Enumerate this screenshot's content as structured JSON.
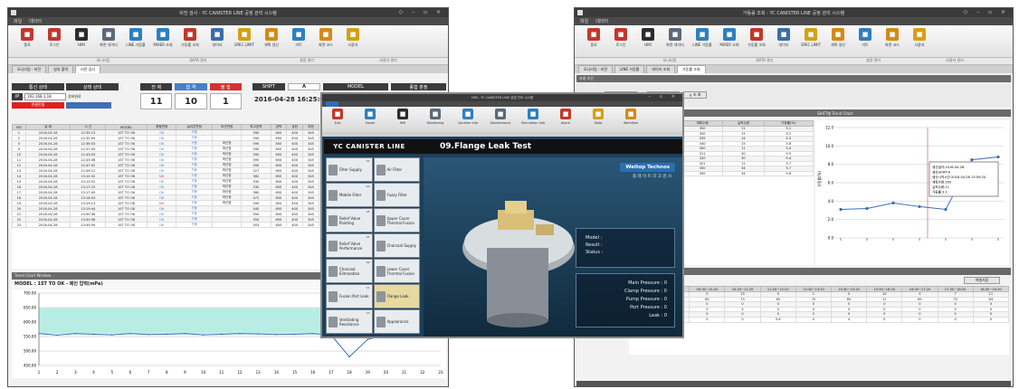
{
  "left": {
    "title": "비전 검사 - YC CANISTER LINE 공정 관리 시스템",
    "menu": [
      "파일",
      "데이터"
    ],
    "ribbon": [
      "종료",
      "로그인",
      "HMI",
      "화면 데이터",
      "LINE 가동률",
      "MIXER 조회",
      "가동률 조회",
      "데이터",
      "SPEC LIMIT",
      "계획 생산",
      "키트",
      "화면 코드",
      "사용자"
    ],
    "groups": [
      "",
      "모니터링",
      "DATA 관리",
      "설정 관리",
      "사용자 관리"
    ],
    "tabs": [
      "모니터링 - 비전",
      "일지 출력",
      "비전 검사"
    ],
    "status_head": [
      "통신 상태",
      "상태 상태"
    ],
    "ip_label": "IP",
    "ip": "192.168.1.18",
    "ip_state": "정비완료",
    "conn": "연결안됨",
    "counts": {
      "total_label": "전 체",
      "ok_label": "합 격",
      "ng_label": "불 합",
      "total": "11",
      "ok": "10",
      "ng": "1"
    },
    "shift_label": "SHIFT",
    "shift": "A",
    "model_label": "MODEL",
    "judge_label": "종합 판정",
    "datetime": "2016-04-28 16:25:05",
    "columns": [
      "NO",
      "날 짜",
      "시 간",
      "MODEL",
      "종합판정",
      "실리콘판정",
      "외관판정",
      "최고압력",
      "압력",
      "상한",
      "하한",
      "최대압력"
    ],
    "rows": [
      [
        "1",
        "2016-04-28",
        "12:35:13",
        "1ST TO OK",
        "OK",
        "가동",
        "",
        "590",
        "650",
        "400",
        "345"
      ],
      [
        "2",
        "2016-04-28",
        "12:35:59",
        "1ST TO OK",
        "OK",
        "가동",
        "",
        "590",
        "650",
        "400",
        "345"
      ],
      [
        "5",
        "2016-04-28",
        "12:36:53",
        "1ST TO OK",
        "OK",
        "가동",
        "마신정",
        "590",
        "650",
        "400",
        "345"
      ],
      [
        "9",
        "2016-04-28",
        "12:37:49",
        "1ST TO OK",
        "OK",
        "가동",
        "마신정",
        "590",
        "650",
        "400",
        "345"
      ],
      [
        "10",
        "2016-04-28",
        "12:43:03",
        "1ST TO OK",
        "OK",
        "가동",
        "마신정",
        "590",
        "650",
        "400",
        "345"
      ],
      [
        "11",
        "2016-04-28",
        "12:43:36",
        "1ST TO OK",
        "OK",
        "가동",
        "마신정",
        "590",
        "650",
        "400",
        "345"
      ],
      [
        "12",
        "2016-04-28",
        "12:47:02",
        "1ST TO OK",
        "OK",
        "가동",
        "마신정",
        "590",
        "650",
        "400",
        "345"
      ],
      [
        "13",
        "2016-04-28",
        "12:49:12",
        "1ST TO OK",
        "OK",
        "가동",
        "마신정",
        "527",
        "650",
        "400",
        "345"
      ],
      [
        "14",
        "2016-04-28",
        "13:10:32",
        "1ST TO OK",
        "NG",
        "가동",
        "마신정",
        "582",
        "650",
        "400",
        "345"
      ],
      [
        "15",
        "2016-04-28",
        "13:12:52",
        "1ST TO OK",
        "OK",
        "가동",
        "마신정",
        "530",
        "650",
        "400",
        "345"
      ],
      [
        "16",
        "2016-04-28",
        "13:17:15",
        "1ST TO OK",
        "OK",
        "가동",
        "마신정",
        "530",
        "650",
        "400",
        "345"
      ],
      [
        "17",
        "2016-04-28",
        "13:17:45",
        "1ST TO OK",
        "OK",
        "가동",
        "마신정",
        "580",
        "650",
        "400",
        "345"
      ],
      [
        "18",
        "2016-04-28",
        "13:18:03",
        "1ST TO OK",
        "OK",
        "가동",
        "마신정",
        "472",
        "650",
        "400",
        "345"
      ],
      [
        "19",
        "2016-04-28",
        "13:19:13",
        "1ST TO OK",
        "NG",
        "가동",
        "마신정",
        "590",
        "650",
        "400",
        "345"
      ],
      [
        "20",
        "2016-04-28",
        "13:19:44",
        "1ST TO OK",
        "OK",
        "가동",
        "",
        "540",
        "650",
        "400",
        "345"
      ],
      [
        "21",
        "2016-04-28",
        "13:50:36",
        "1ST TO OK",
        "OK",
        "가동",
        "",
        "550",
        "650",
        "400",
        "345"
      ],
      [
        "22",
        "2016-04-28",
        "13:50:56",
        "1ST TO OK",
        "OK",
        "가동",
        "",
        "550",
        "650",
        "400",
        "345"
      ],
      [
        "23",
        "2016-04-28",
        "13:50:59",
        "1ST TO OK",
        "OK",
        "가동",
        "",
        "553",
        "650",
        "400",
        "345"
      ]
    ],
    "trend_head": "Trend Chart Window",
    "trend_title": "MODEL : 1ST TO OK - 메인 압력(mPa)",
    "yticks": [
      "700.00",
      "650.00",
      "600.00",
      "550.00",
      "500.00",
      "450.00"
    ],
    "xticks": [
      "1",
      "2",
      "3",
      "4",
      "5",
      "6",
      "7",
      "8",
      "9",
      "10",
      "11",
      "12",
      "13",
      "14",
      "15",
      "16",
      "17",
      "18",
      "19",
      "20",
      "21",
      "22",
      "23"
    ]
  },
  "mid": {
    "title": "HMI - YC CANISTER LINE 공정 관리 시스템",
    "ribbon": [
      "Exit",
      "Home",
      "HMI",
      "Monitoring",
      "Canister Info",
      "Maintenance",
      "Simulation Info",
      "Alarm",
      "Data",
      "Workflow"
    ],
    "brand": "YC CANISTER LINE",
    "station_title": "09.Flange Leak Test",
    "company": "Weltop Technos",
    "subtitle": "플 레 이 트 리 크 검 사",
    "stations": [
      {
        "n": "01",
        "a": "Filter Supply",
        "b": "Air Filter"
      },
      {
        "n": "03",
        "a": "Mobile Filter",
        "b": "Fuzzy Filter"
      },
      {
        "n": "05",
        "a": "Relief Valve Painting",
        "b": "Upper Cover Thermal Fusion"
      },
      {
        "n": "07",
        "a": "Relief Valve Performance",
        "b": "Charcoal Supply"
      },
      {
        "n": "09",
        "a": "Charcoal Elimination",
        "b": "Lower Cover Thermal Fusion"
      },
      {
        "n": "11",
        "a": "Fusion Part Leak",
        "b": "Flange Leak"
      },
      {
        "n": "13",
        "a": "Ventilating Resistance",
        "b": "Appearance"
      }
    ],
    "info": {
      "model": "Model :",
      "result": "Result :",
      "status": "Status :"
    },
    "pressures": [
      "Main Pressure : 0",
      "Clamp Pressure : 0",
      "Pump Pressure : 0",
      "Port Pressure : 0",
      "Leak : 0"
    ]
  },
  "right": {
    "title": "가동률 조회 - YC CANISTER LINE 공정 관리 시스템",
    "tabs": [
      "모니터링 - 비전",
      "LINE 가동률",
      "데이터 조회",
      "가동률 조회"
    ],
    "search_label": "조회 조건",
    "date_label": "조회일자",
    "date_from": "2016-05-21",
    "date_to": "2016-05-22",
    "search_btn": "조 회",
    "cols": [
      "계획수량",
      "실적수량",
      "가동률(%)"
    ],
    "rows": [
      [
        "350",
        "11",
        "3.1"
      ],
      [
        "350",
        "15",
        "3.2"
      ],
      [
        "335",
        "14",
        "4.3"
      ],
      [
        "340",
        "15",
        "3.8"
      ],
      [
        "300",
        "11",
        "3.4"
      ],
      [
        "311",
        "30",
        "9.5"
      ],
      [
        "320",
        "30",
        "9.4"
      ],
      [
        "321",
        "12",
        "3.7"
      ],
      [
        "350",
        "34",
        "9.7"
      ],
      [
        "350",
        "34",
        "9.8"
      ]
    ],
    "chart_title": "SHIFT별 Trend Chart",
    "chart_yticks": [
      "12.0",
      "10.0",
      "8.0",
      "6.0",
      "4.0",
      "2.0",
      "0.0"
    ],
    "ylabel": "가동률(%)",
    "tooltip": [
      "생산일자:2016-04-28",
      "생산SHIFT:A",
      "생산시작시간:2016-04-28 15:59:24",
      "계획수량:350",
      "실적수량:11",
      "가동률:3.1"
    ],
    "bottom_btn": "엑셀저장",
    "bottom_cols": [
      "08:30~09:20",
      "09:30~10:20",
      "10:30~11:20",
      "11:30~12:20",
      "13:30~14:20",
      "14:30~15:20",
      "15:30~16:20",
      "16:30~17:20",
      "17:30~18:20",
      "18:30~19:20"
    ],
    "bottom_rows": [
      [
        "0",
        "0",
        "15",
        "0",
        "1",
        "0",
        "10",
        "0",
        "7",
        "11"
      ],
      [
        "85",
        "85",
        "75",
        "85",
        "75",
        "85",
        "11",
        "85",
        "70",
        "83"
      ],
      [
        "0",
        "0",
        "0",
        "0",
        "0",
        "0",
        "0",
        "0",
        "0",
        "0"
      ],
      [
        "0",
        "0",
        "4",
        "0",
        "0",
        "0",
        "0",
        "0",
        "0",
        "0"
      ],
      [
        "0",
        "0",
        "0",
        "0",
        "0",
        "0",
        "0",
        "0",
        "0",
        "0"
      ]
    ],
    "bottom_last_label": "가동률(%)",
    "bottom_last": [
      "1.4",
      "0",
      "0",
      "5.6",
      "0",
      "4",
      "0",
      "0",
      "0",
      "0"
    ]
  },
  "chart_data": [
    {
      "type": "line",
      "title": "MODEL : 1ST TO OK - 메인 압력(mPa)",
      "ylim": [
        450,
        700
      ],
      "x": [
        1,
        2,
        3,
        4,
        5,
        6,
        7,
        8,
        9,
        10,
        11,
        12,
        13,
        14,
        15,
        16,
        17,
        18,
        19,
        20,
        21,
        22,
        23
      ],
      "series": [
        {
          "values": [
            560,
            555,
            560,
            558,
            556,
            560,
            557,
            558,
            560,
            556,
            558,
            560,
            559,
            557,
            558,
            560,
            555,
            480,
            540,
            556,
            560,
            558,
            560
          ]
        }
      ]
    },
    {
      "type": "line",
      "title": "SHIFT별 Trend Chart",
      "ylim": [
        0,
        12
      ],
      "series": [
        {
          "values": [
            3.1,
            3.2,
            3.8,
            3.4,
            3.1,
            8.5,
            8.8
          ]
        }
      ]
    }
  ]
}
